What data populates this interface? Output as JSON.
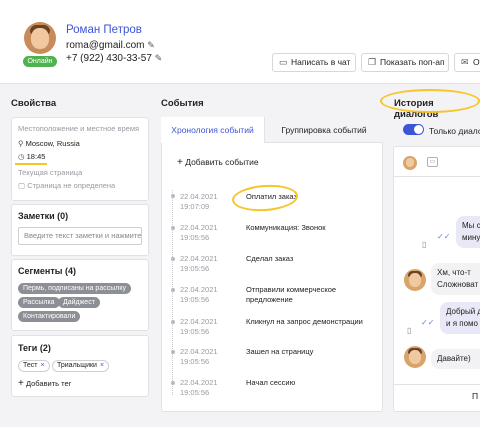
{
  "profile": {
    "name": "Роман Петров",
    "email": "roma@gmail.com",
    "phone": "+7 (922) 430-33-57",
    "status": "Онлайн"
  },
  "header_buttons": [
    {
      "label": "Написать в чат",
      "icon": "chat-icon"
    },
    {
      "label": "Показать поп-ап",
      "icon": "popup-icon"
    },
    {
      "label": "От",
      "icon": "mail-icon"
    }
  ],
  "properties": {
    "title": "Свойства",
    "location_label": "Местоположение и местное время",
    "location": "Moscow, Russia",
    "time": "18:45",
    "current_page_label": "Текущая страница",
    "current_page": "Страница не определена"
  },
  "notes": {
    "title": "Заметки (0)",
    "placeholder": "Введите текст заметки и нажмите..."
  },
  "segments": {
    "title": "Сегменты (4)",
    "items": [
      "Пермь, подписаны на рассылку",
      "Рассылка",
      "Дайджест",
      "Контактировали"
    ]
  },
  "tags": {
    "title": "Теги (2)",
    "items": [
      "Тест",
      "Триальщики"
    ],
    "add_label": "Добавить тег"
  },
  "events": {
    "title": "События",
    "tabs": [
      "Хронология событий",
      "Группировка событий"
    ],
    "add_label": "Добавить событие",
    "items": [
      {
        "date": "22.04.2021",
        "time": "19:07:09",
        "text": "Оплатил заказ"
      },
      {
        "date": "22.04.2021",
        "time": "19:05:56",
        "text": "Коммуникация: Звонок"
      },
      {
        "date": "22.04.2021",
        "time": "19:05:56",
        "text": "Сделал заказ"
      },
      {
        "date": "22.04.2021",
        "time": "19:05:56",
        "text": "Отправили коммерческое предложение"
      },
      {
        "date": "22.04.2021",
        "time": "19:05:56",
        "text": "Кликнул на запрос демонстрации"
      },
      {
        "date": "22.04.2021",
        "time": "19:05:56",
        "text": "Зашел на страницу"
      },
      {
        "date": "22.04.2021",
        "time": "19:05:56",
        "text": "Начал сессию"
      }
    ]
  },
  "dialogs": {
    "title": "История диалогов",
    "toggle_label": "Только диалоги",
    "messages": [
      {
        "side": "out",
        "lines": [
          "Мы с",
          "мину"
        ]
      },
      {
        "side": "in",
        "lines": [
          "Хм, что-т",
          "Сложноват"
        ]
      },
      {
        "side": "out",
        "lines": [
          "Добрый д",
          "и я помо"
        ]
      },
      {
        "side": "in",
        "lines": [
          "Давайте)"
        ]
      }
    ],
    "bottom_label": "П"
  },
  "colors": {
    "accent": "#3b55d6",
    "online": "#4fb24f",
    "highlight": "#f7c52a",
    "bubble": "#e9e8f6"
  }
}
